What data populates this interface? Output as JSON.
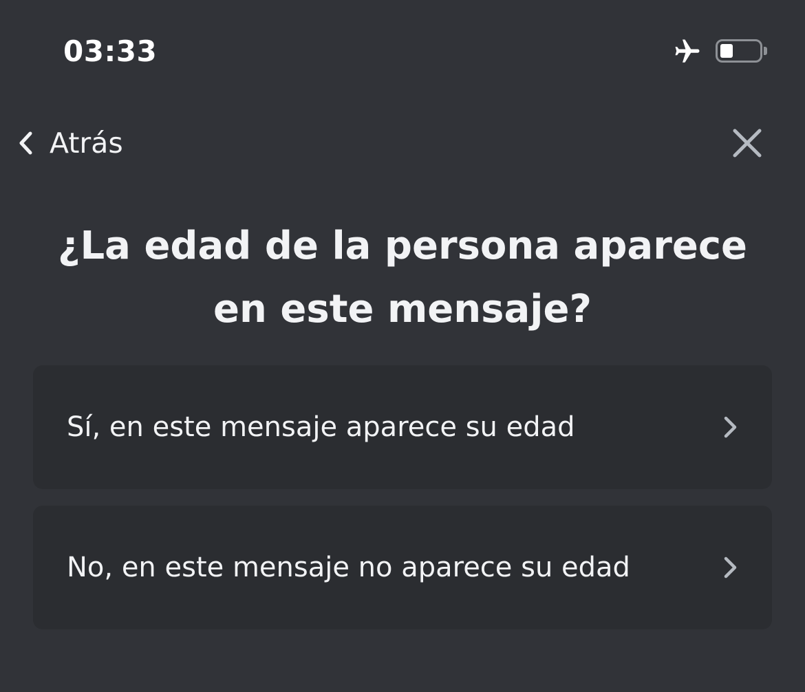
{
  "status_bar": {
    "time": "03:33",
    "airplane_icon": "airplane-icon",
    "battery_icon": "battery-icon",
    "battery_level": 0.3
  },
  "nav": {
    "back_label": "Atrás",
    "back_icon": "chevron-left-icon",
    "close_icon": "close-icon"
  },
  "question": "¿La edad de la persona aparece en este mensaje?",
  "options": [
    {
      "label": "Sí, en este mensaje aparece su edad",
      "icon": "chevron-right-icon"
    },
    {
      "label": "No, en este mensaje no aparece su edad",
      "icon": "chevron-right-icon"
    }
  ],
  "colors": {
    "background": "#313338",
    "card": "#2b2d31",
    "text": "#f2f3f5",
    "icon_muted": "#b5bac1"
  }
}
